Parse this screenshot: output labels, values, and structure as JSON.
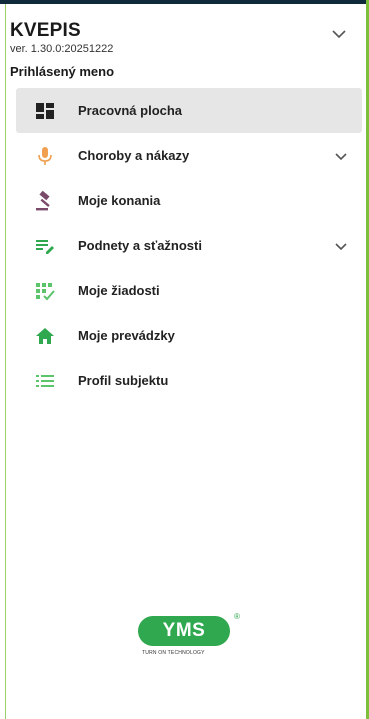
{
  "app": {
    "title": "KVEPIS",
    "version": "ver. 1.30.0:20251222",
    "user": "Prihlásený meno"
  },
  "menu": {
    "items": [
      {
        "label": "Pracovná plocha",
        "icon": "dashboard-icon",
        "active": true,
        "expandable": false
      },
      {
        "label": "Choroby a nákazy",
        "icon": "microphone-icon",
        "active": false,
        "expandable": true
      },
      {
        "label": "Moje konania",
        "icon": "gavel-icon",
        "active": false,
        "expandable": false
      },
      {
        "label": "Podnety a sťažnosti",
        "icon": "edit-list-icon",
        "active": false,
        "expandable": true
      },
      {
        "label": "Moje žiadosti",
        "icon": "grid-check-icon",
        "active": false,
        "expandable": false
      },
      {
        "label": "Moje prevádzky",
        "icon": "home-icon",
        "active": false,
        "expandable": false
      },
      {
        "label": "Profil subjektu",
        "icon": "list-icon",
        "active": false,
        "expandable": false
      }
    ]
  },
  "logo": {
    "name": "YMS",
    "registered": "®",
    "tagline": "TURN ON TECHNOLOGY"
  },
  "colors": {
    "active_bg": "#e6e6e6",
    "accent_green": "#2fa84f",
    "icon_orange": "#f0a050",
    "icon_purple": "#7a4a6a",
    "icon_green_light": "#5cc46a",
    "border_green": "#7bbf3a"
  }
}
